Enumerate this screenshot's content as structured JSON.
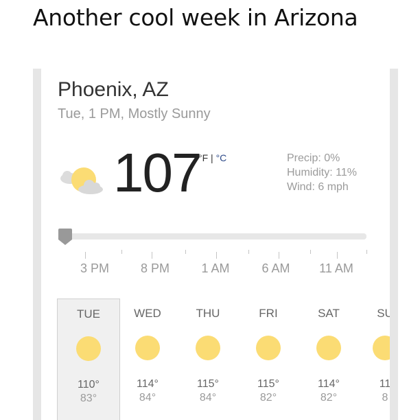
{
  "caption": "Another cool week in Arizona",
  "location": {
    "city": "Phoenix, AZ",
    "subtitle": "Tue, 1 PM, Mostly Sunny"
  },
  "current": {
    "icon": "partly-sunny-icon",
    "temperature": "107",
    "unit_f": "°F",
    "unit_sep": " | ",
    "unit_c": "°C",
    "precip": "Precip: 0%",
    "humidity": "Humidity: 11%",
    "wind": "Wind: 6 mph"
  },
  "timeline": {
    "selected_position": 0,
    "labels": [
      "3 PM",
      "8 PM",
      "1 AM",
      "6 AM",
      "11 AM"
    ]
  },
  "forecast": [
    {
      "day": "TUE",
      "high": "110°",
      "low": "83°",
      "icon": "sun-icon",
      "selected": true
    },
    {
      "day": "WED",
      "high": "114°",
      "low": "84°",
      "icon": "sun-icon",
      "selected": false
    },
    {
      "day": "THU",
      "high": "115°",
      "low": "84°",
      "icon": "sun-icon",
      "selected": false
    },
    {
      "day": "FRI",
      "high": "115°",
      "low": "82°",
      "icon": "sun-icon",
      "selected": false
    },
    {
      "day": "SAT",
      "high": "114°",
      "low": "82°",
      "icon": "sun-icon",
      "selected": false
    },
    {
      "day": "SU",
      "high": "11",
      "low": "8",
      "icon": "sun-icon",
      "selected": false
    }
  ],
  "colors": {
    "sun": "#fbdc74",
    "cloud": "#dcdcdc",
    "celsius_link": "#2d4a88"
  }
}
